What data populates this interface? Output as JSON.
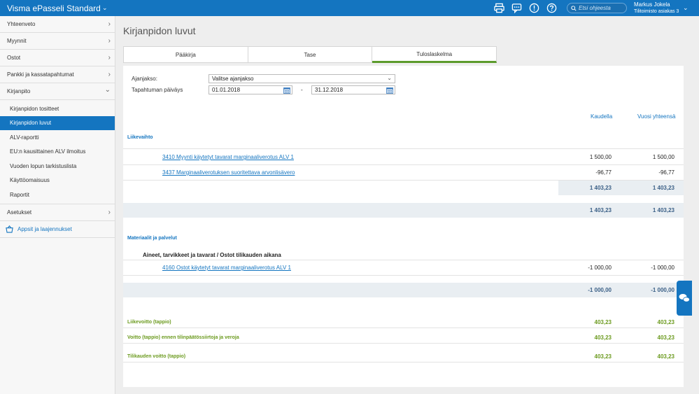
{
  "app": {
    "title": "Visma ePasseli Standard"
  },
  "search": {
    "placeholder": "Etsi ohjeesta"
  },
  "user": {
    "name": "Markus Jokela",
    "org": "Tilitoimisto asiakas 3"
  },
  "sidebar": {
    "items": [
      {
        "label": "Yhteenveto"
      },
      {
        "label": "Myynnit"
      },
      {
        "label": "Ostot"
      },
      {
        "label": "Pankki ja kassatapahtumat"
      },
      {
        "label": "Kirjanpito"
      }
    ],
    "sub_items": [
      {
        "label": "Kirjanpidon tositteet"
      },
      {
        "label": "Kirjanpidon luvut"
      },
      {
        "label": "ALV-raportti"
      },
      {
        "label": "EU:n kausittainen ALV ilmoitus"
      },
      {
        "label": "Vuoden lopun tarkistuslista"
      },
      {
        "label": "Käyttöomaisuus"
      },
      {
        "label": "Raportit"
      }
    ],
    "settings": {
      "label": "Asetukset"
    },
    "apps": {
      "label": "Appsit ja laajennukset"
    }
  },
  "page": {
    "title": "Kirjanpidon luvut"
  },
  "tabs": [
    {
      "label": "Pääkirja"
    },
    {
      "label": "Tase"
    },
    {
      "label": "Tuloslaskelma"
    }
  ],
  "filters": {
    "period_label": "Ajanjakso:",
    "period_value": "Valitse ajanjakso",
    "date_label": "Tapahtuman päiväys",
    "date_from": "01.01.2018",
    "date_sep": "-",
    "date_to": "31.12.2018"
  },
  "columns": {
    "period": "Kaudella",
    "year": "Vuosi yhteensä"
  },
  "report": {
    "revenue": {
      "title": "Liikevaihto",
      "rows": [
        {
          "account": "3410 Myynti käytetyt tavarat marginaaliverotus ALV 1",
          "period": "1 500,00",
          "year": "1 500,00"
        },
        {
          "account": "3437 Marginaaliverotuksen suoritettava arvonlisävero",
          "period": "-96,77",
          "year": "-96,77"
        }
      ],
      "subtotal": {
        "period": "1 403,23",
        "year": "1 403,23"
      },
      "total": {
        "period": "1 403,23",
        "year": "1 403,23"
      }
    },
    "materials": {
      "title": "Materiaalit ja palvelut",
      "subtitle": "Aineet, tarvikkeet ja tavarat / Ostot tilikauden aikana",
      "rows": [
        {
          "account": "4160 Ostot käytetyt tavarat marginaaliverotus ALV 1",
          "period": "-1 000,00",
          "year": "-1 000,00"
        }
      ],
      "total": {
        "period": "-1 000,00",
        "year": "-1 000,00"
      }
    },
    "results": [
      {
        "label": "Liikevoitto (tappio)",
        "period": "403,23",
        "year": "403,23"
      },
      {
        "label": "Voitto (tappio) ennen tilinpäätössiirtoja ja veroja",
        "period": "403,23",
        "year": "403,23"
      },
      {
        "label": "Tilikauden voitto (tappio)",
        "period": "403,23",
        "year": "403,23"
      }
    ]
  },
  "colors": {
    "brand": "#1475c0",
    "positive": "#6b9a1e",
    "active_tab_underline": "#5c9b2c"
  }
}
